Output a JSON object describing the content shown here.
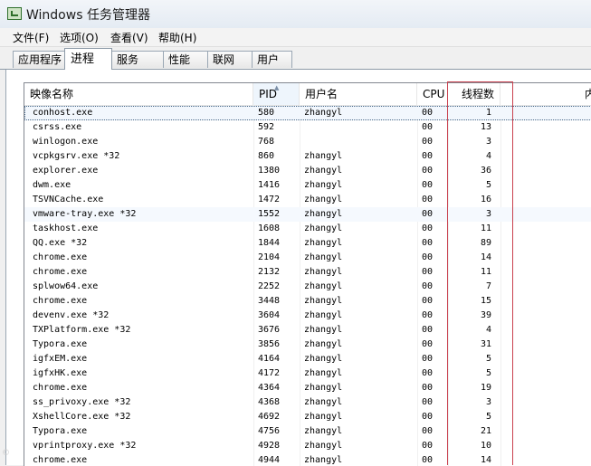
{
  "window": {
    "title": "Windows 任务管理器"
  },
  "menu": [
    {
      "label": "文件(F)"
    },
    {
      "label": "选项(O)"
    },
    {
      "label": "查看(V)"
    },
    {
      "label": "帮助(H)"
    }
  ],
  "tabs": [
    {
      "label": "应用程序"
    },
    {
      "label": "进程",
      "active": true
    },
    {
      "label": "服务"
    },
    {
      "label": "性能"
    },
    {
      "label": "联网"
    },
    {
      "label": "用户"
    }
  ],
  "columns": [
    {
      "label": "映像名称"
    },
    {
      "label": "PID",
      "sorted": true
    },
    {
      "label": "用户名"
    },
    {
      "label": "CPU"
    },
    {
      "label": "线程数"
    },
    {
      "label": "内"
    }
  ],
  "rows": [
    {
      "name": "conhost.exe",
      "pid": "580",
      "user": "zhangyl",
      "cpu": "00",
      "threads": "1",
      "selected": true
    },
    {
      "name": "csrss.exe",
      "pid": "592",
      "user": "",
      "cpu": "00",
      "threads": "13"
    },
    {
      "name": "winlogon.exe",
      "pid": "768",
      "user": "",
      "cpu": "00",
      "threads": "3"
    },
    {
      "name": "vcpkgsrv.exe *32",
      "pid": "860",
      "user": "zhangyl",
      "cpu": "00",
      "threads": "4"
    },
    {
      "name": "explorer.exe",
      "pid": "1380",
      "user": "zhangyl",
      "cpu": "00",
      "threads": "36"
    },
    {
      "name": "dwm.exe",
      "pid": "1416",
      "user": "zhangyl",
      "cpu": "00",
      "threads": "5"
    },
    {
      "name": "TSVNCache.exe",
      "pid": "1472",
      "user": "zhangyl",
      "cpu": "00",
      "threads": "16"
    },
    {
      "name": "vmware-tray.exe *32",
      "pid": "1552",
      "user": "zhangyl",
      "cpu": "00",
      "threads": "3",
      "hover": true
    },
    {
      "name": "taskhost.exe",
      "pid": "1608",
      "user": "zhangyl",
      "cpu": "00",
      "threads": "11"
    },
    {
      "name": "QQ.exe *32",
      "pid": "1844",
      "user": "zhangyl",
      "cpu": "00",
      "threads": "89"
    },
    {
      "name": "chrome.exe",
      "pid": "2104",
      "user": "zhangyl",
      "cpu": "00",
      "threads": "14"
    },
    {
      "name": "chrome.exe",
      "pid": "2132",
      "user": "zhangyl",
      "cpu": "00",
      "threads": "11"
    },
    {
      "name": "splwow64.exe",
      "pid": "2252",
      "user": "zhangyl",
      "cpu": "00",
      "threads": "7"
    },
    {
      "name": "chrome.exe",
      "pid": "3448",
      "user": "zhangyl",
      "cpu": "00",
      "threads": "15"
    },
    {
      "name": "devenv.exe *32",
      "pid": "3604",
      "user": "zhangyl",
      "cpu": "00",
      "threads": "39"
    },
    {
      "name": "TXPlatform.exe *32",
      "pid": "3676",
      "user": "zhangyl",
      "cpu": "00",
      "threads": "4"
    },
    {
      "name": "Typora.exe",
      "pid": "3856",
      "user": "zhangyl",
      "cpu": "00",
      "threads": "31"
    },
    {
      "name": "igfxEM.exe",
      "pid": "4164",
      "user": "zhangyl",
      "cpu": "00",
      "threads": "5"
    },
    {
      "name": "igfxHK.exe",
      "pid": "4172",
      "user": "zhangyl",
      "cpu": "00",
      "threads": "5"
    },
    {
      "name": "chrome.exe",
      "pid": "4364",
      "user": "zhangyl",
      "cpu": "00",
      "threads": "19"
    },
    {
      "name": "ss_privoxy.exe *32",
      "pid": "4368",
      "user": "zhangyl",
      "cpu": "00",
      "threads": "3"
    },
    {
      "name": "XshellCore.exe *32",
      "pid": "4692",
      "user": "zhangyl",
      "cpu": "00",
      "threads": "5"
    },
    {
      "name": "Typora.exe",
      "pid": "4756",
      "user": "zhangyl",
      "cpu": "00",
      "threads": "21"
    },
    {
      "name": "vprintproxy.exe *32",
      "pid": "4928",
      "user": "zhangyl",
      "cpu": "00",
      "threads": "10"
    },
    {
      "name": "chrome.exe",
      "pid": "4944",
      "user": "zhangyl",
      "cpu": "00",
      "threads": "14"
    }
  ],
  "watermark": "©",
  "colors": {
    "highlight_box": "#c9424f",
    "selection_bg": "#f2f7fd"
  }
}
